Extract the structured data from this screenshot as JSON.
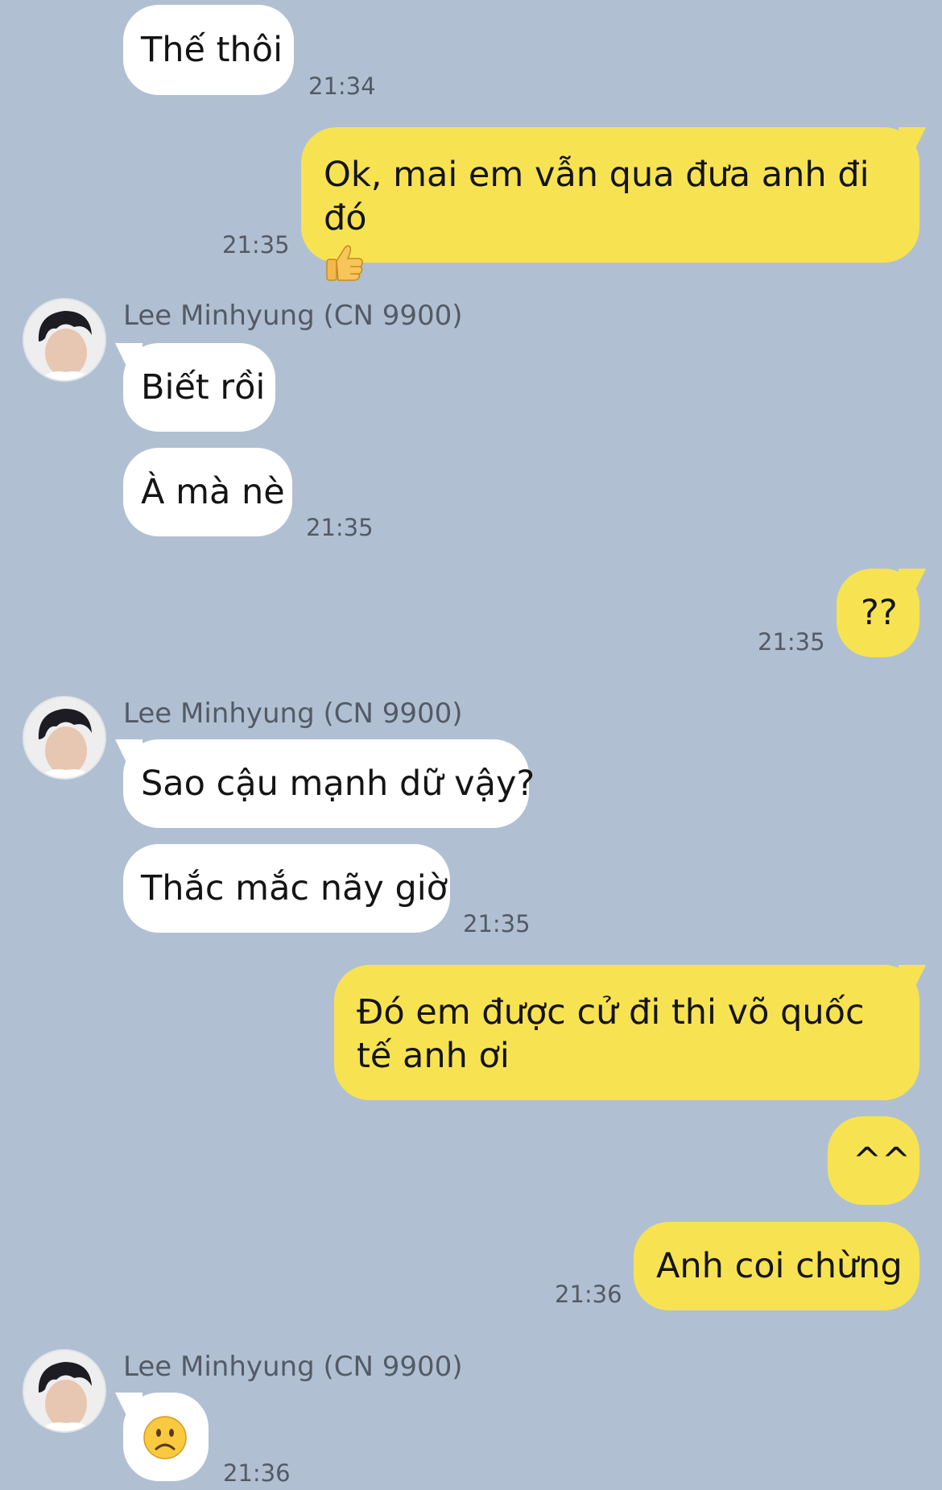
{
  "chat": {
    "sender_name": "Lee Minhyung (CN 9900)",
    "messages": [
      {
        "id": "m1",
        "dir": "in",
        "text": "Thế thôi"
      },
      {
        "id": "m2",
        "dir": "out",
        "text": "Ok, mai em vẫn qua đưa anh đi đó",
        "emoji": "thumbs-up"
      },
      {
        "id": "m3",
        "dir": "in",
        "text": "Biết rồi"
      },
      {
        "id": "m4",
        "dir": "in",
        "text": "À mà nè"
      },
      {
        "id": "m5",
        "dir": "out",
        "text": "??"
      },
      {
        "id": "m6",
        "dir": "in",
        "text": "Sao cậu mạnh dữ vậy?"
      },
      {
        "id": "m7",
        "dir": "in",
        "text": "Thắc mắc nãy giờ"
      },
      {
        "id": "m8",
        "dir": "out",
        "text": "Đó em được cử đi thi võ quốc tế anh ơi"
      },
      {
        "id": "m9",
        "dir": "out",
        "text": "^^"
      },
      {
        "id": "m10",
        "dir": "out",
        "text": "Anh coi chừng"
      },
      {
        "id": "m11",
        "dir": "in",
        "emoji": "frowning-face"
      }
    ],
    "timestamps": {
      "t1": "21:34",
      "t2": "21:35",
      "t3": "21:35",
      "t4": "21:35",
      "t5": "21:35",
      "t6": "21:36",
      "t7": "21:36"
    }
  },
  "colors": {
    "background": "#b0c0d2",
    "incoming_bubble": "#ffffff",
    "outgoing_bubble": "#f7e352",
    "meta_text": "#535a66"
  }
}
